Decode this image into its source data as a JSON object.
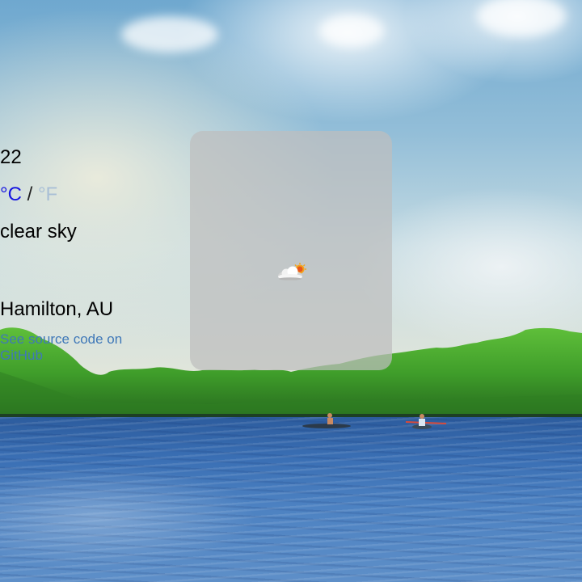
{
  "weather": {
    "temperature": "22",
    "unit_celsius": "°C",
    "unit_separator": "/",
    "unit_fahrenheit": "°F",
    "active_unit": "celsius",
    "description": "clear sky",
    "icon": "partly-cloudy-icon",
    "location": "Hamilton, AU"
  },
  "footer": {
    "source_link_line1": "See source code on",
    "source_link_line2": "GitHub"
  },
  "colors": {
    "active_unit": "#1515e0",
    "inactive_unit": "#a9bfd6",
    "link": "#3f78b8",
    "card_background": "rgba(190,190,190,0.72)"
  }
}
